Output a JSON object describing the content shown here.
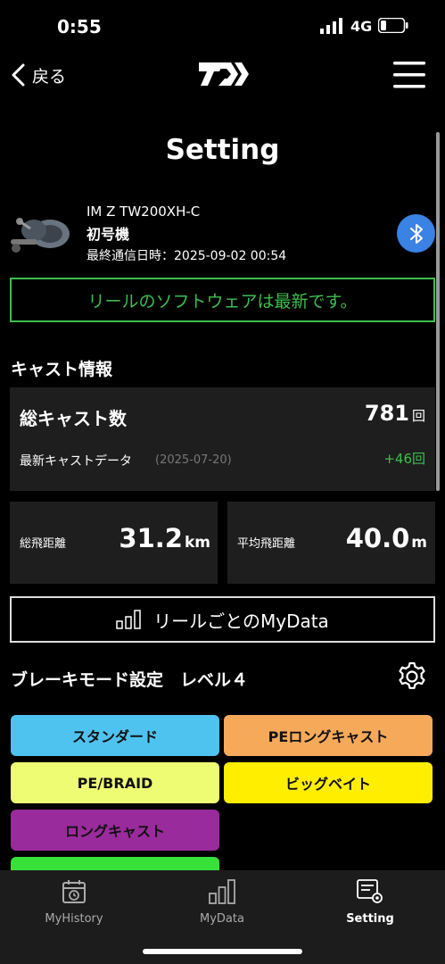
{
  "status": {
    "time": "0:55",
    "network": "4G"
  },
  "nav": {
    "back_label": "戻る"
  },
  "page": {
    "title": "Setting"
  },
  "reel": {
    "model": "IM Z TW200XH-C",
    "name": "初号機",
    "last_comm": "最終通信日時：2025-09-02 00:54",
    "software_status": "リールのソフトウェアは最新です。"
  },
  "cast": {
    "section_title": "キャスト情報",
    "total_label": "総キャスト数",
    "total_value": "781",
    "total_unit": "回",
    "latest_label": "最新キャストデータ",
    "latest_date": "(2025-07-20)",
    "latest_value": "+46回"
  },
  "distance": {
    "total_label": "総飛距離",
    "total_value": "31.2",
    "total_unit": "km",
    "avg_label": "平均飛距離",
    "avg_value": "40.0",
    "avg_unit": "m"
  },
  "mydata_button": {
    "label": "リールごとのMyData"
  },
  "brake": {
    "title": "ブレーキモード設定　レベル４",
    "modes": [
      {
        "label": "スタンダード",
        "color": "#4fc3f0"
      },
      {
        "label": "PEロングキャスト",
        "color": "#f7a95a"
      },
      {
        "label": "PE/BRAID",
        "color": "#eefc74"
      },
      {
        "label": "ビッグベイト",
        "color": "#ffee00"
      },
      {
        "label": "ロングキャスト",
        "color": "#9a2b9c"
      },
      {
        "label": "",
        "color": "#37e13a"
      }
    ]
  },
  "tabs": [
    {
      "label": "MyHistory",
      "icon": "calendar-icon"
    },
    {
      "label": "MyData",
      "icon": "bar-chart-icon"
    },
    {
      "label": "Setting",
      "icon": "settings-list-icon"
    }
  ],
  "colors": {
    "accent_green": "#3cbe50",
    "bluetooth_blue": "#3a82e4"
  }
}
